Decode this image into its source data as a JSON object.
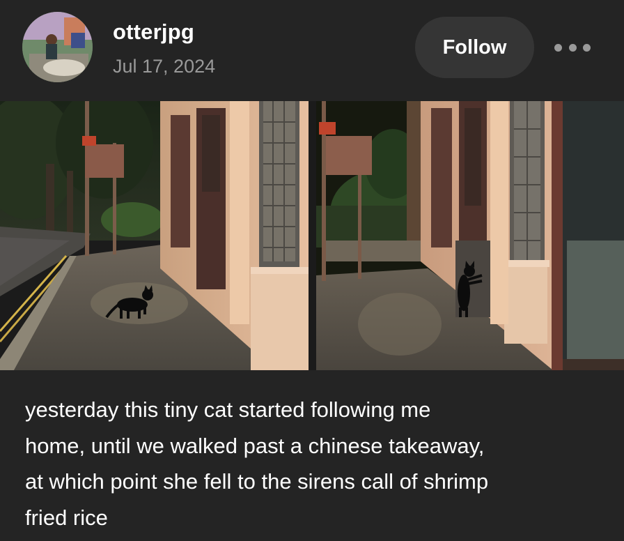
{
  "post": {
    "author": {
      "username": "otterjpg",
      "avatar_icon": "user-avatar"
    },
    "date": "Jul 17, 2024",
    "follow_label": "Follow",
    "more_icon": "ellipsis-icon",
    "images": [
      {
        "icon": "cat-photo-walking"
      },
      {
        "icon": "cat-photo-standing-at-door"
      }
    ],
    "caption_lines": [
      "yesterday this tiny cat started following me",
      "home, until we walked past a chinese takeaway,",
      "at which point she fell to the sirens call of shrimp",
      "fried rice"
    ]
  },
  "colors": {
    "background": "#242424",
    "button_bg": "#353535",
    "muted_text": "#9a9a9a",
    "text": "#ffffff"
  }
}
